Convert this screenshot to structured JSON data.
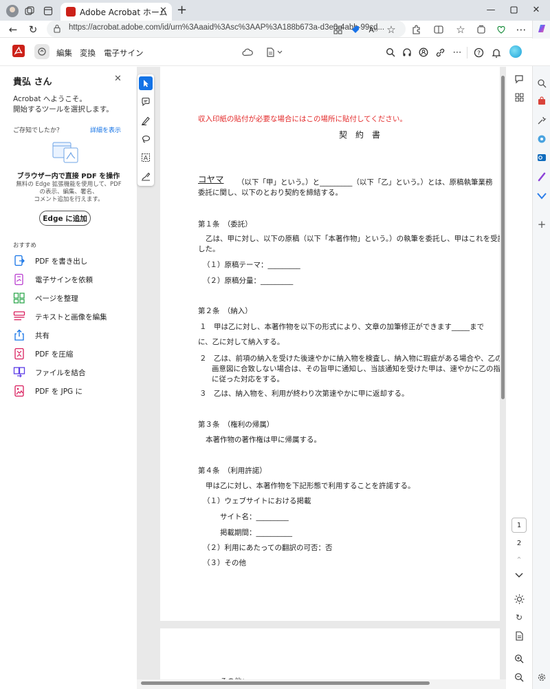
{
  "browser": {
    "tab_title": "Adobe Acrobat ホーム",
    "url": "https://acrobat.adobe.com/id/urn%3Aaaid%3Asc%3AAP%3A188b673a-d3e0-4abb-99cd..."
  },
  "app": {
    "menus": [
      "編集",
      "変換",
      "電子サイン"
    ],
    "colors": {
      "brand": "#cc2119",
      "accent": "#1473e6",
      "active_tool": "#1473e6"
    }
  },
  "left_panel": {
    "greeting": "貴弘 さん",
    "welcome_line1": "Acrobat へようこそ。",
    "welcome_line2": "開始するツールを選択します。",
    "tip_label": "ご存知でしたか？",
    "tip_link": "詳細を表示",
    "promo_title": "ブラウザー内で直接 PDF を操作",
    "promo_desc_line1": "無料の Edge 拡張機能を使用して、PDF",
    "promo_desc_line2": "の表示、編集、署名、",
    "promo_desc_line3": "コメント追加を行えます。",
    "promo_button": "Edge に追加",
    "recommend_label": "おすすめ",
    "tools": [
      {
        "label": "PDF を書き出し",
        "icon": "export-pdf-icon",
        "color": "#1473e6"
      },
      {
        "label": "電子サインを依頼",
        "icon": "request-esign-icon",
        "color": "#b83ccf"
      },
      {
        "label": "ページを整理",
        "icon": "organize-pages-icon",
        "color": "#2fa84f"
      },
      {
        "label": "テキストと画像を編集",
        "icon": "edit-text-image-icon",
        "color": "#d91c5c"
      },
      {
        "label": "共有",
        "icon": "share-icon",
        "color": "#1473e6"
      },
      {
        "label": "PDF を圧縮",
        "icon": "compress-pdf-icon",
        "color": "#d91c5c"
      },
      {
        "label": "ファイルを結合",
        "icon": "combine-files-icon",
        "color": "#5c3ce6"
      },
      {
        "label": "PDF を JPG に",
        "icon": "pdf-to-jpg-icon",
        "color": "#d91c5c"
      }
    ]
  },
  "document": {
    "stamp_note": "収入印紙の貼付が必要な場合にはこの場所に貼付してください。",
    "title": "契　約　書",
    "intro_name": "コヤマ",
    "intro_rest": "（以下「甲」という。）と_________（以下「乙」という。）とは、原稿執筆業務",
    "intro_line2": "委託に関し、以下のとおり契約を締結する。",
    "a1_head": "第１条　（委託）",
    "a1_body1": "乙は、甲に対し、以下の原稿（以下「本著作物」という。）の執筆を委託し、甲はこれを受託",
    "a1_body2": "した。",
    "a1_item1": "（１）原稿テーマ：_________",
    "a1_item2": "（２）原稿分量：_________",
    "a2_head": "第２条　（納入）",
    "a2_p1_line1": "１　甲は乙に対し、本著作物を以下の形式により、文章の加筆修正ができます_____まで",
    "a2_p1_line2": "に、乙に対して納入する。",
    "a2_p2_line1": "２　乙は、前項の納入を受けた後速やかに納入物を検査し、納入物に瑕疵がある場合や、乙の",
    "a2_p2_line2": "画意図に合致しない場合は、その旨甲に通知し、当該通知を受けた甲は、速やかに乙の指",
    "a2_p2_line3": "に従った対応をする。",
    "a2_p3": "３　乙は、納入物を、利用が終わり次第速やかに甲に返却する。",
    "a3_head": "第３条　（権利の帰属）",
    "a3_body": "本著作物の著作権は甲に帰属する。",
    "a4_head": "第４条　（利用許諾）",
    "a4_body": "甲は乙に対し、本著作物を下記形態で利用することを許諾する。",
    "a4_item1": "（１）ウェブサイトにおける掲載",
    "a4_item1_site": "サイト名：_________",
    "a4_item1_period": "掲載期間：__________",
    "a4_item2": "（２）利用にあたっての翻訳の可否：否",
    "a4_item3": "（３）その他",
    "page2_text": "その他："
  },
  "pager": {
    "page1": "1",
    "page2": "2"
  }
}
